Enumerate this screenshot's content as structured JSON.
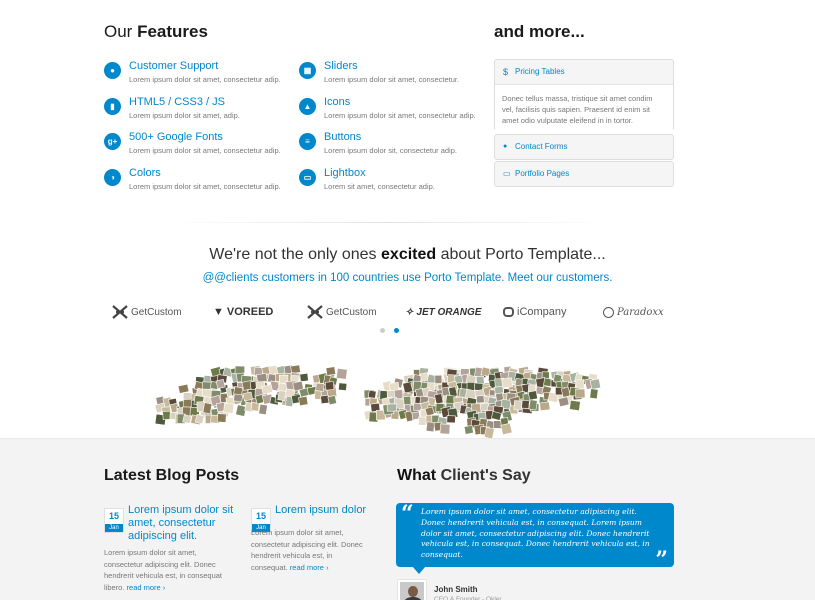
{
  "features": {
    "title_prefix": "Our",
    "title_bold": "Features",
    "items": [
      {
        "title": "Customer Support",
        "desc": "Lorem ipsum dolor sit amet, consectetur adip.",
        "icon": "user-icon"
      },
      {
        "title": "HTML5 / CSS3 / JS",
        "desc": "Lorem ipsum dolor sit amet, adip.",
        "icon": "file-icon"
      },
      {
        "title": "500+ Google Fonts",
        "desc": "Lorem ipsum dolor sit amet, consectetur adip.",
        "icon": "google-plus-icon"
      },
      {
        "title": "Colors",
        "desc": "Lorem ipsum dolor sit amet, consectetur adip.",
        "icon": "contrast-icon"
      },
      {
        "title": "Sliders",
        "desc": "Lorem ipsum dolor sit amet, consectetur.",
        "icon": "film-icon"
      },
      {
        "title": "Icons",
        "desc": "Lorem ipsum dolor sit amet, consectetur adip.",
        "icon": "flask-icon"
      },
      {
        "title": "Buttons",
        "desc": "Lorem ipsum dolor sit, consectetur adip.",
        "icon": "list-icon"
      },
      {
        "title": "Lightbox",
        "desc": "Lorem sit amet, consectetur adip.",
        "icon": "desktop-icon"
      }
    ]
  },
  "more": {
    "title": "and more...",
    "accordion": [
      {
        "label": "Pricing Tables",
        "icon": "dollar-icon",
        "symbol": "$",
        "open": true,
        "body": "Donec tellus massa, tristique sit amet condim vel, facilisis quis sapien. Praesent id enim sit amet odio vulputate eleifend in in tortor."
      },
      {
        "label": "Contact Forms",
        "icon": "comment-icon",
        "symbol": "💬",
        "open": false
      },
      {
        "label": "Portfolio Pages",
        "icon": "laptop-icon",
        "symbol": "💻",
        "open": false
      }
    ]
  },
  "clients": {
    "heading_pre": "We're not the only ones",
    "heading_bold": "excited",
    "heading_post": "about Porto Template...",
    "sub": "@@clients customers in 100 countries use Porto Template. Meet our customers.",
    "logos": [
      "GetCustom",
      "VOREED",
      "GetCustom",
      "JET ORANGE",
      "iCompany",
      "Paradoxx"
    ],
    "carousel_pages": 2,
    "carousel_active": 2
  },
  "blog": {
    "title_prefix": "Latest",
    "title_bold": "Blog",
    "title_suffix": "Posts",
    "posts": [
      {
        "day": "15",
        "month": "Jan",
        "title": "Lorem ipsum dolor sit amet, consectetur adipiscing elit.",
        "excerpt": "Lorem ipsum dolor sit amet, consectetur adipiscing elit. Donec hendrerit vehicula est, in consequat libero.",
        "read_more": "read more ›"
      },
      {
        "day": "15",
        "month": "Jan",
        "title": "Lorem ipsum dolor",
        "excerpt": "Lorem ipsum dolor sit amet, consectetur adipiscing elit. Donec hendrerit vehicula est, in consequat.",
        "read_more": "read more ›"
      }
    ]
  },
  "testimonial": {
    "title_bold": "What",
    "title_rest": "Client's Say",
    "quote": "Lorem ipsum dolor sit amet, consectetur adipiscing elit. Donec hendrerit vehicula est, in consequat. Lorem ipsum dolor sit amet, consectetur adipiscing elit. Donec hendrerit vehicula est, in consequat. Donec hendrerit vehicula est, in consequat.",
    "author": "John Smith",
    "role": "CEO & Founder - Okler"
  },
  "colors": {
    "accent": "#0088cc",
    "band": "#f3f3f3"
  }
}
